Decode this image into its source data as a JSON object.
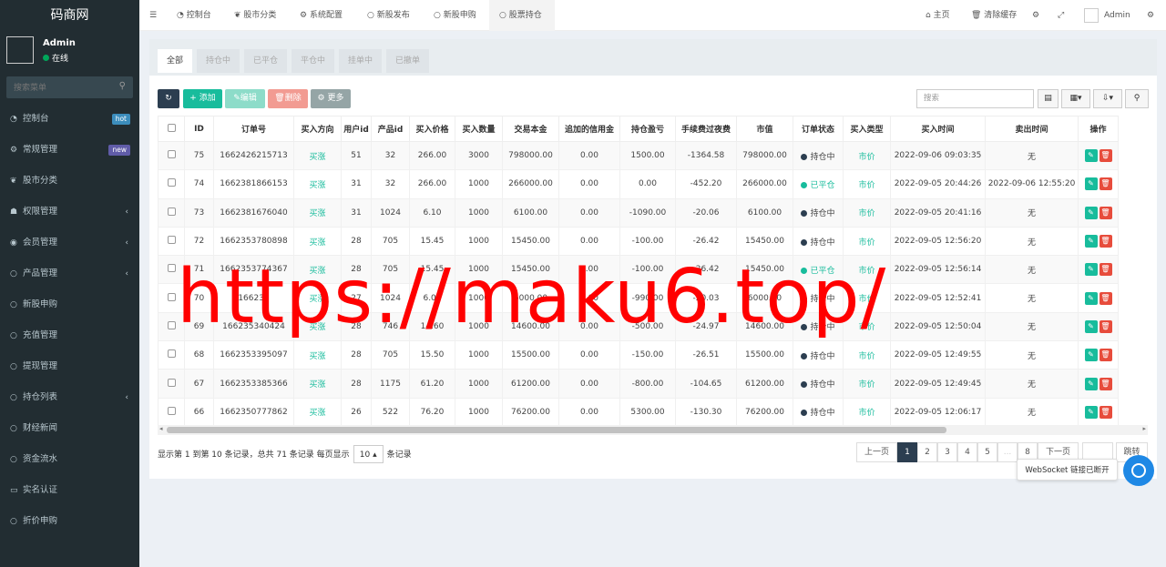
{
  "sidebar": {
    "logo": "码商网",
    "user": {
      "name": "Admin",
      "status": "在线"
    },
    "search_placeholder": "搜索菜单",
    "items": [
      {
        "label": "控制台",
        "badge": "hot"
      },
      {
        "label": "常规管理",
        "badge": "new"
      },
      {
        "label": "股市分类"
      },
      {
        "label": "权限管理"
      },
      {
        "label": "会员管理"
      },
      {
        "label": "产品管理"
      },
      {
        "label": "新股申购"
      },
      {
        "label": "充值管理"
      },
      {
        "label": "提现管理"
      },
      {
        "label": "持仓列表"
      },
      {
        "label": "财经新闻"
      },
      {
        "label": "资金流水"
      },
      {
        "label": "实名认证"
      },
      {
        "label": "折价申购"
      }
    ]
  },
  "topbar": {
    "tabs": [
      "控制台",
      "股市分类",
      "系统配置",
      "新股发布",
      "新股申购",
      "股票持仓"
    ],
    "home": "主页",
    "clear_cache": "清除缓存",
    "admin": "Admin"
  },
  "filter_tabs": [
    "全部",
    "持仓中",
    "已平仓",
    "平仓中",
    "挂单中",
    "已撤单"
  ],
  "toolbar": {
    "add": "添加",
    "edit": "编辑",
    "delete": "删除",
    "more": "更多",
    "search_placeholder": "搜索"
  },
  "table": {
    "headers": [
      "ID",
      "订单号",
      "买入方向",
      "用户id",
      "产品id",
      "买入价格",
      "买入数量",
      "交易本金",
      "追加的信用金",
      "持仓盈亏",
      "手续费过夜费",
      "市值",
      "订单状态",
      "买入类型",
      "买入时间",
      "卖出时间",
      "操作"
    ],
    "rows": [
      [
        "75",
        "1662426215713",
        "买涨",
        "51",
        "32",
        "266.00",
        "3000",
        "798000.00",
        "0.00",
        "1500.00",
        "-1364.58",
        "798000.00",
        "持仓中",
        "市价",
        "2022-09-06 09:03:35",
        "无"
      ],
      [
        "74",
        "1662381866153",
        "买涨",
        "31",
        "32",
        "266.00",
        "1000",
        "266000.00",
        "0.00",
        "0.00",
        "-452.20",
        "266000.00",
        "已平仓",
        "市价",
        "2022-09-05 20:44:26",
        "2022-09-06 12:55:20"
      ],
      [
        "73",
        "1662381676040",
        "买涨",
        "31",
        "1024",
        "6.10",
        "1000",
        "6100.00",
        "0.00",
        "-1090.00",
        "-20.06",
        "6100.00",
        "持仓中",
        "市价",
        "2022-09-05 20:41:16",
        "无"
      ],
      [
        "72",
        "1662353780898",
        "买涨",
        "28",
        "705",
        "15.45",
        "1000",
        "15450.00",
        "0.00",
        "-100.00",
        "-26.42",
        "15450.00",
        "持仓中",
        "市价",
        "2022-09-05 12:56:20",
        "无"
      ],
      [
        "71",
        "1662353774367",
        "买涨",
        "28",
        "705",
        "15.45",
        "1000",
        "15450.00",
        "0.00",
        "-100.00",
        "-26.42",
        "15450.00",
        "已平仓",
        "市价",
        "2022-09-05 12:56:14",
        "无"
      ],
      [
        "70",
        "166235",
        "买涨",
        "27",
        "1024",
        "6.00",
        "1000",
        "6000.00",
        "0.00",
        "-990.00",
        "-20.03",
        "6000.00",
        "持仓中",
        "市价",
        "2022-09-05 12:52:41",
        "无"
      ],
      [
        "69",
        "166235340424",
        "买涨",
        "28",
        "746",
        "14.60",
        "1000",
        "14600.00",
        "0.00",
        "-500.00",
        "-24.97",
        "14600.00",
        "持仓中",
        "市价",
        "2022-09-05 12:50:04",
        "无"
      ],
      [
        "68",
        "1662353395097",
        "买涨",
        "28",
        "705",
        "15.50",
        "1000",
        "15500.00",
        "0.00",
        "-150.00",
        "-26.51",
        "15500.00",
        "持仓中",
        "市价",
        "2022-09-05 12:49:55",
        "无"
      ],
      [
        "67",
        "1662353385366",
        "买涨",
        "28",
        "1175",
        "61.20",
        "1000",
        "61200.00",
        "0.00",
        "-800.00",
        "-104.65",
        "61200.00",
        "持仓中",
        "市价",
        "2022-09-05 12:49:45",
        "无"
      ],
      [
        "66",
        "1662350777862",
        "买涨",
        "26",
        "522",
        "76.20",
        "1000",
        "76200.00",
        "0.00",
        "5300.00",
        "-130.30",
        "76200.00",
        "持仓中",
        "市价",
        "2022-09-05 12:06:17",
        "无"
      ]
    ]
  },
  "pagination": {
    "info_prefix": "显示第 1 到第 10 条记录，总共 71 条记录 每页显示",
    "page_size": "10",
    "info_suffix": "条记录",
    "prev": "上一页",
    "pages": [
      "1",
      "2",
      "3",
      "4",
      "5",
      "...",
      "8"
    ],
    "next": "下一页",
    "jump": "跳转"
  },
  "ws_toast": "WebSocket 链接已断开",
  "watermark": "https://maku6.top/",
  "colors": {
    "sidebar_bg": "#222d32",
    "accent_green": "#18bc9c",
    "danger": "#e74c3c",
    "closed_status": "#18bc9c",
    "holding_status": "#2c3e50"
  }
}
